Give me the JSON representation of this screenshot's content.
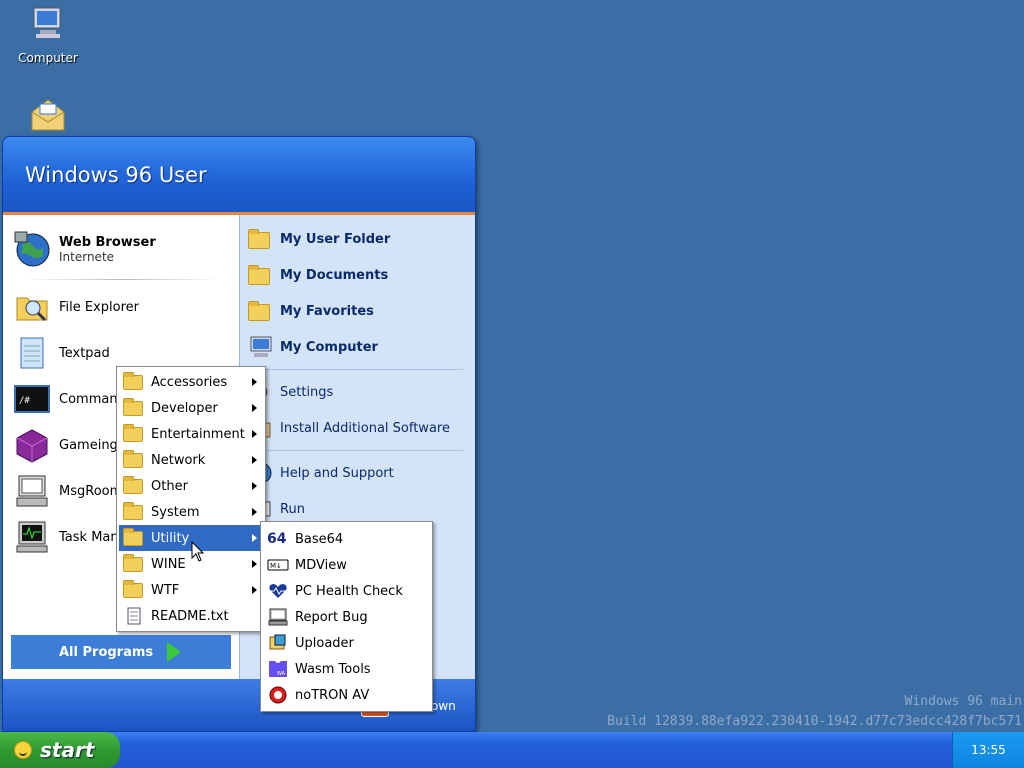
{
  "desktop": {
    "icons": [
      {
        "label": "Computer",
        "icon": "computer-icon"
      },
      {
        "label": "",
        "icon": "mail-icon"
      }
    ],
    "build_line1": "Windows 96 main",
    "build_line2": "Build 12839.88efa922.230410-1942.d77c73edcc428f7bc571"
  },
  "start_menu": {
    "user_name": "Windows 96 User",
    "pinned": {
      "title": "Web Browser",
      "subtitle": "Internete",
      "icon": "globe-icon"
    },
    "left_items": [
      {
        "label": "File Explorer",
        "icon": "file-explorer-icon"
      },
      {
        "label": "Textpad",
        "icon": "notepad-icon"
      },
      {
        "label": "Command",
        "icon": "terminal-icon"
      },
      {
        "label": "Gameing",
        "icon": "game-cube-icon"
      },
      {
        "label": "MsgRoom",
        "icon": "msgroom-icon"
      },
      {
        "label": "Task Mana",
        "icon": "task-manager-icon"
      }
    ],
    "all_programs": "All Programs",
    "right_items": [
      {
        "label": "My User Folder",
        "icon": "folder-icon"
      },
      {
        "label": "My Documents",
        "icon": "documents-folder-icon"
      },
      {
        "label": "My Favorites",
        "icon": "favorites-folder-icon"
      },
      {
        "label": "My Computer",
        "icon": "computer-icon"
      }
    ],
    "right_items2": [
      {
        "label": "Settings",
        "icon": "settings-icon"
      },
      {
        "label": "Install Additional Software",
        "icon": "install-icon"
      }
    ],
    "right_items3": [
      {
        "label": "Help and Support",
        "icon": "help-icon"
      },
      {
        "label": "Run",
        "icon": "run-icon"
      }
    ],
    "shutdown_partial": "own"
  },
  "programs_menu": [
    {
      "label": "Accessories",
      "has_sub": true
    },
    {
      "label": "Developer",
      "has_sub": true
    },
    {
      "label": "Entertainment",
      "has_sub": true
    },
    {
      "label": "Network",
      "has_sub": true
    },
    {
      "label": "Other",
      "has_sub": true
    },
    {
      "label": "System",
      "has_sub": true
    },
    {
      "label": "Utility",
      "has_sub": true,
      "selected": true
    },
    {
      "label": "WINE",
      "has_sub": true
    },
    {
      "label": "WTF",
      "has_sub": true
    },
    {
      "label": "README.txt",
      "has_sub": false
    }
  ],
  "utility_menu": [
    {
      "label": "Base64",
      "icon": "base64-icon"
    },
    {
      "label": "MDView",
      "icon": "markdown-icon"
    },
    {
      "label": "PC Health Check",
      "icon": "heart-icon"
    },
    {
      "label": "Report Bug",
      "icon": "report-bug-icon"
    },
    {
      "label": "Uploader",
      "icon": "uploader-icon"
    },
    {
      "label": "Wasm Tools",
      "icon": "wasm-icon"
    },
    {
      "label": "noTRON AV",
      "icon": "antivirus-icon"
    }
  ],
  "taskbar": {
    "start_label": "start",
    "clock": "13:55"
  }
}
